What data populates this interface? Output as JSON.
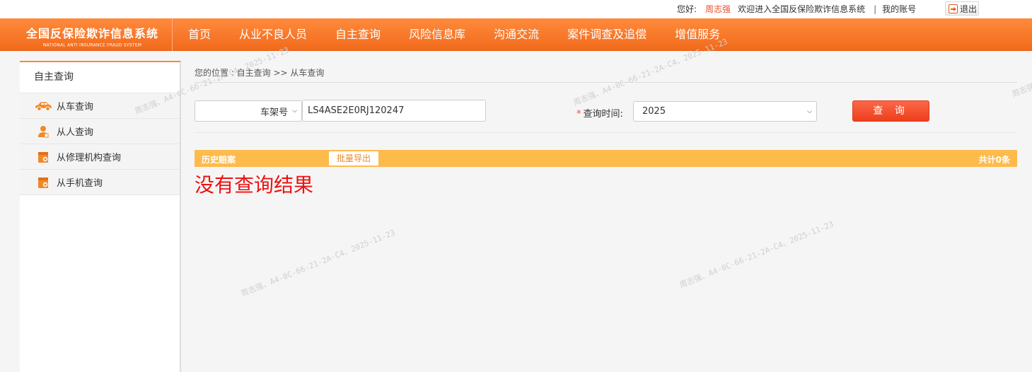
{
  "topbar": {
    "greeting": "您好:",
    "username": "周志强",
    "welcome": "欢迎进入全国反保险欺诈信息系统",
    "separator": "|",
    "my_account": "我的账号",
    "logout": "退出"
  },
  "brand": {
    "cn": "全国反保险欺诈信息系统",
    "en": "NATIONAL ANTI INSURANCE FRAUD SYSTEM"
  },
  "nav": {
    "items": [
      {
        "label": "首页"
      },
      {
        "label": "从业不良人员"
      },
      {
        "label": "自主查询"
      },
      {
        "label": "风险信息库"
      },
      {
        "label": "沟通交流"
      },
      {
        "label": "案件调查及追偿"
      },
      {
        "label": "增值服务"
      }
    ]
  },
  "sidebar": {
    "title": "自主查询",
    "items": [
      {
        "label": "从车查询",
        "icon": "car-icon"
      },
      {
        "label": "从人查询",
        "icon": "person-icon"
      },
      {
        "label": "从修理机构查询",
        "icon": "repair-shop-icon"
      },
      {
        "label": "从手机查询",
        "icon": "phone-icon"
      }
    ]
  },
  "breadcrumb": "您的位置 : 自主查询 >> 从车查询",
  "form": {
    "type_select_value": "车架号",
    "vin_value": "LS4ASE2E0RJ120247",
    "required_mark": "*",
    "time_label": "查询时间:",
    "year_value": "2025",
    "query_button": "查 询"
  },
  "results": {
    "bar_title": "历史赔案",
    "export_button": "批量导出",
    "total": "共计0条",
    "empty_message": "没有查询结果"
  },
  "watermark": "周志强、A4-0C-66-21-2A-C4、2025-11-23",
  "colors": {
    "nav_orange": "#f26a1b",
    "result_bar": "#fdbb4c",
    "query_button": "#ee3e1c",
    "empty_text": "#ee1111",
    "username": "#e8502a"
  }
}
